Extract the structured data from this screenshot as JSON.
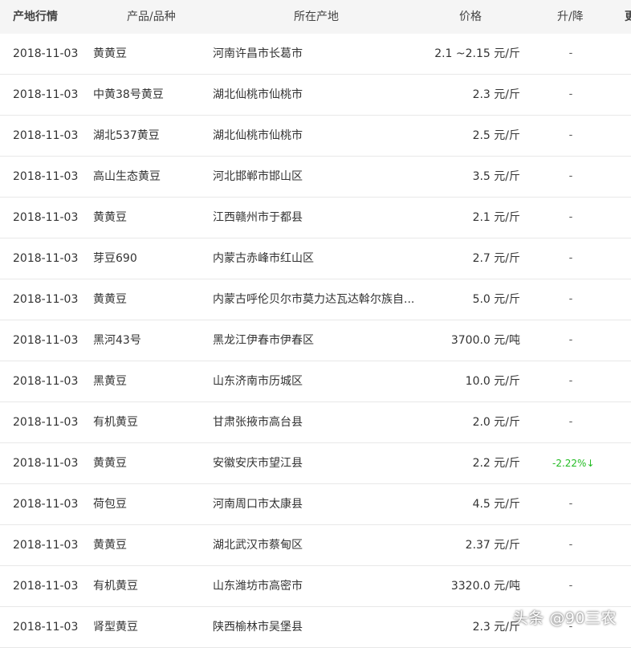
{
  "header": {
    "date_label": "产地行情",
    "name_label": "产品/品种",
    "place_label": "所在产地",
    "price_label": "价格",
    "change_label": "升/降",
    "extra_label": "更"
  },
  "rows": [
    {
      "date": "2018-11-03",
      "name": "黄黄豆",
      "place": "河南许昌市长葛市",
      "price": "2.1 ~2.15 元/斤",
      "change": "-"
    },
    {
      "date": "2018-11-03",
      "name": "中黄38号黄豆",
      "place": "湖北仙桃市仙桃市",
      "price": "2.3 元/斤",
      "change": "-"
    },
    {
      "date": "2018-11-03",
      "name": "湖北537黄豆",
      "place": "湖北仙桃市仙桃市",
      "price": "2.5 元/斤",
      "change": "-"
    },
    {
      "date": "2018-11-03",
      "name": "高山生态黄豆",
      "place": "河北邯郸市邯山区",
      "price": "3.5 元/斤",
      "change": "-"
    },
    {
      "date": "2018-11-03",
      "name": "黄黄豆",
      "place": "江西赣州市于都县",
      "price": "2.1 元/斤",
      "change": "-"
    },
    {
      "date": "2018-11-03",
      "name": "芽豆690",
      "place": "内蒙古赤峰市红山区",
      "price": "2.7 元/斤",
      "change": "-"
    },
    {
      "date": "2018-11-03",
      "name": "黄黄豆",
      "place": "内蒙古呼伦贝尔市莫力达瓦达斡尔族自...",
      "price": "5.0 元/斤",
      "change": "-"
    },
    {
      "date": "2018-11-03",
      "name": "黑河43号",
      "place": "黑龙江伊春市伊春区",
      "price": "3700.0 元/吨",
      "change": "-"
    },
    {
      "date": "2018-11-03",
      "name": "黑黄豆",
      "place": "山东济南市历城区",
      "price": "10.0 元/斤",
      "change": "-"
    },
    {
      "date": "2018-11-03",
      "name": "有机黄豆",
      "place": "甘肃张掖市高台县",
      "price": "2.0 元/斤",
      "change": "-"
    },
    {
      "date": "2018-11-03",
      "name": "黄黄豆",
      "place": "安徽安庆市望江县",
      "price": "2.2 元/斤",
      "change": "-2.22%↓",
      "change_dir": "down"
    },
    {
      "date": "2018-11-03",
      "name": "荷包豆",
      "place": "河南周口市太康县",
      "price": "4.5 元/斤",
      "change": "-"
    },
    {
      "date": "2018-11-03",
      "name": "黄黄豆",
      "place": "湖北武汉市蔡甸区",
      "price": "2.37 元/斤",
      "change": "-"
    },
    {
      "date": "2018-11-03",
      "name": "有机黄豆",
      "place": "山东潍坊市高密市",
      "price": "3320.0 元/吨",
      "change": "-"
    },
    {
      "date": "2018-11-03",
      "name": "肾型黄豆",
      "place": "陕西榆林市吴堡县",
      "price": "2.3 元/斤",
      "change": "-"
    }
  ],
  "watermark": "头条 @90三农",
  "colors": {
    "down": "#22bb22",
    "header_bg": "#f5f5f5"
  }
}
